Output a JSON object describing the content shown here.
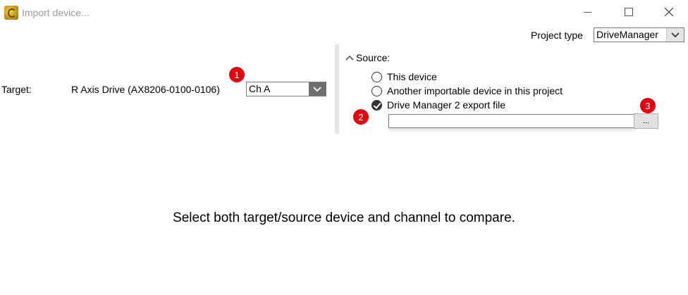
{
  "window": {
    "title": "Import device...",
    "icon": "app-gear-icon",
    "controls": {
      "minimize": "minimize-icon",
      "maximize": "maximize-icon",
      "close": "close-icon"
    }
  },
  "project_type": {
    "label": "Project type",
    "value": "DriveManager"
  },
  "target": {
    "label": "Target:",
    "device": "R Axis Drive (AX8206-0100-0106)",
    "channel": "Ch A"
  },
  "source": {
    "header": "Source:",
    "options": [
      {
        "label": "This device",
        "checked": false
      },
      {
        "label": "Another importable device in this project",
        "checked": false
      },
      {
        "label": "Drive Manager 2 export file",
        "checked": true
      }
    ],
    "file_path": "",
    "browse_label": "..."
  },
  "badges": {
    "one": "1",
    "two": "2",
    "three": "3",
    "color": "#e3000f"
  },
  "message": "Select both target/source device and channel to compare."
}
